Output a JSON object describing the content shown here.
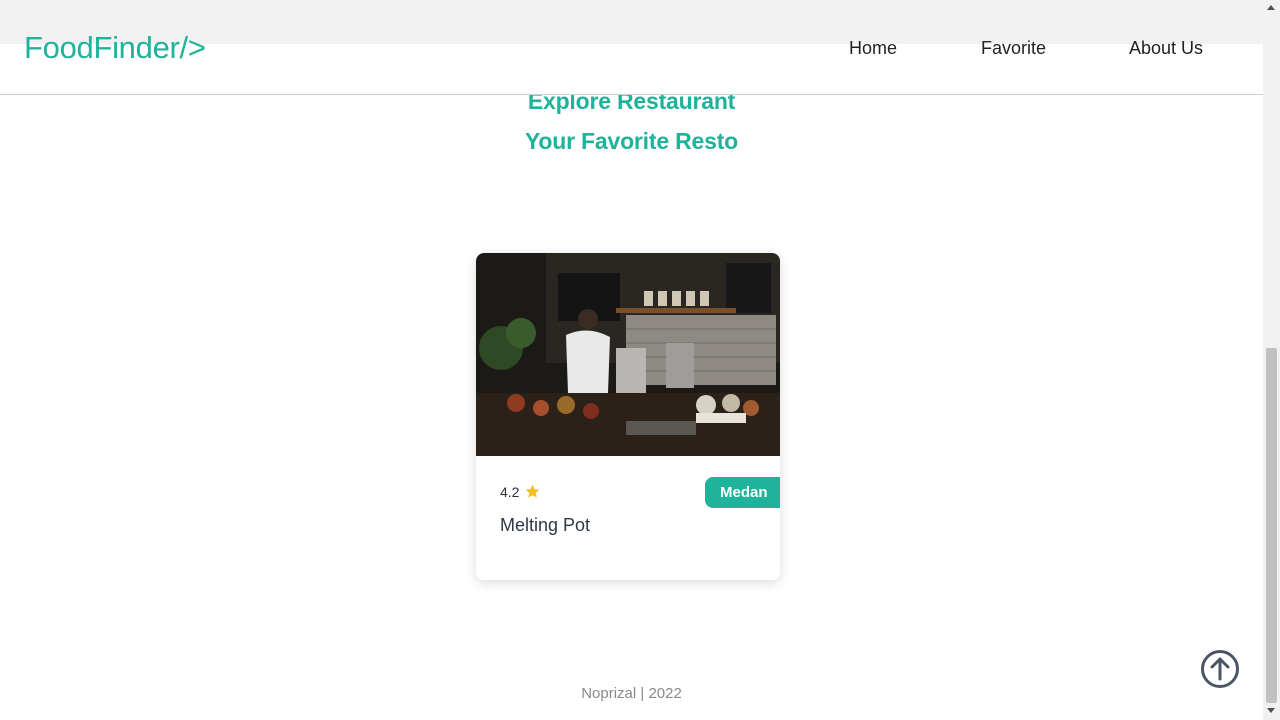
{
  "header": {
    "brand": "FoodFinder/>",
    "nav": [
      {
        "label": "Home"
      },
      {
        "label": "Favorite"
      },
      {
        "label": "About Us"
      }
    ]
  },
  "main": {
    "heading_explore": "Explore Restaurant",
    "heading_favorite": "Your Favorite Resto",
    "cards": [
      {
        "city": "Medan",
        "rating": "4.2",
        "name": "Melting Pot",
        "rating_icon": "star-icon"
      }
    ]
  },
  "footer": {
    "text": "Noprizal | 2022"
  },
  "icons": {
    "scroll_top": "arrow-up-circle-icon"
  },
  "colors": {
    "accent": "#1eb39a",
    "star": "#f6c021",
    "footer_text": "#8a8a8a",
    "scroll_top": "#4a5568"
  }
}
